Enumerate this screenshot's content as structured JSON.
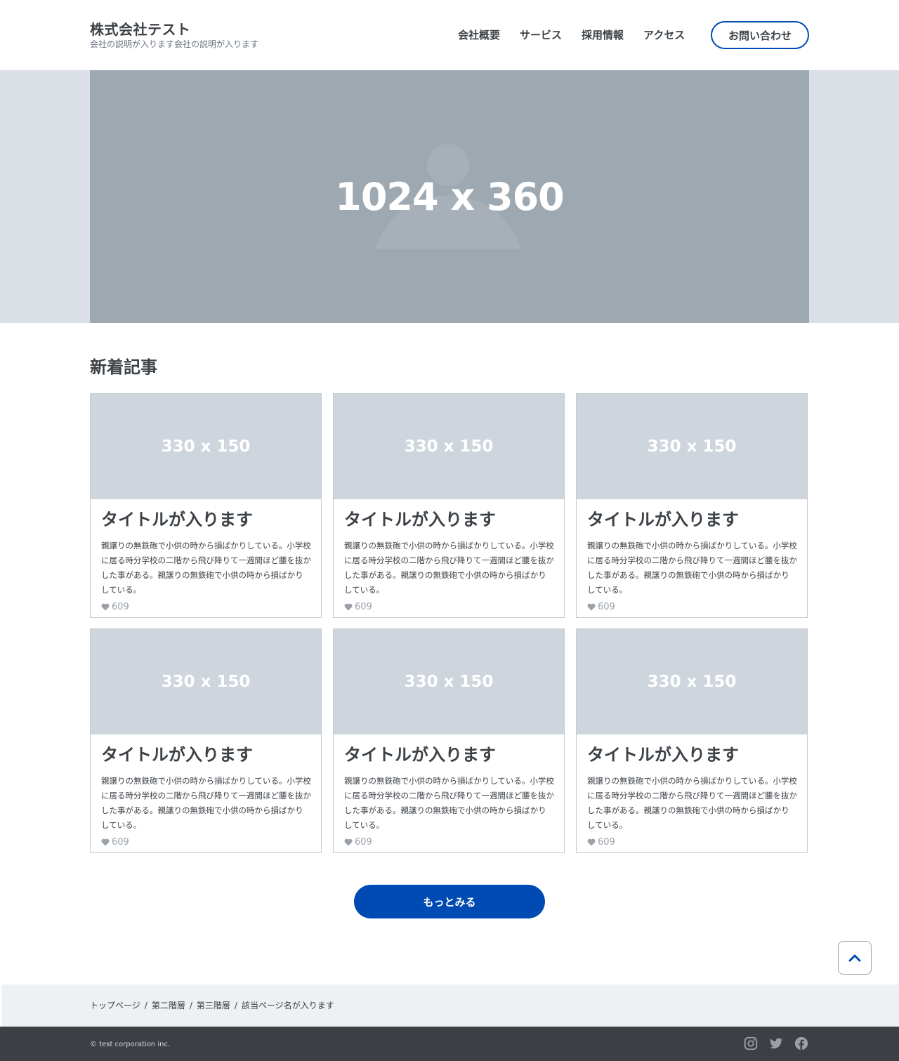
{
  "header": {
    "brand_name": "株式会社テスト",
    "brand_desc": "会社の説明が入ります会社の説明が入ります",
    "nav": [
      {
        "label": "会社概要"
      },
      {
        "label": "サービス"
      },
      {
        "label": "採用情報"
      },
      {
        "label": "アクセス"
      }
    ],
    "contact_label": "お問い合わせ"
  },
  "hero": {
    "label": "1024 x 360"
  },
  "section": {
    "title": "新着記事"
  },
  "cards": [
    {
      "image_label": "330 x 150",
      "title": "タイトルが入ります",
      "text": "親譲りの無鉄砲で小供の時から損ばかりしている。小学校に居る時分学校の二階から飛び降りて一週間ほど腰を抜かした事がある。親譲りの無鉄砲で小供の時から損ばかりしている。",
      "likes": "609"
    },
    {
      "image_label": "330 x 150",
      "title": "タイトルが入ります",
      "text": "親譲りの無鉄砲で小供の時から損ばかりしている。小学校に居る時分学校の二階から飛び降りて一週間ほど腰を抜かした事がある。親譲りの無鉄砲で小供の時から損ばかりしている。",
      "likes": "609"
    },
    {
      "image_label": "330 x 150",
      "title": "タイトルが入ります",
      "text": "親譲りの無鉄砲で小供の時から損ばかりしている。小学校に居る時分学校の二階から飛び降りて一週間ほど腰を抜かした事がある。親譲りの無鉄砲で小供の時から損ばかりしている。",
      "likes": "609"
    },
    {
      "image_label": "330 x 150",
      "title": "タイトルが入ります",
      "text": "親譲りの無鉄砲で小供の時から損ばかりしている。小学校に居る時分学校の二階から飛び降りて一週間ほど腰を抜かした事がある。親譲りの無鉄砲で小供の時から損ばかりしている。",
      "likes": "609"
    },
    {
      "image_label": "330 x 150",
      "title": "タイトルが入ります",
      "text": "親譲りの無鉄砲で小供の時から損ばかりしている。小学校に居る時分学校の二階から飛び降りて一週間ほど腰を抜かした事がある。親譲りの無鉄砲で小供の時から損ばかりしている。",
      "likes": "609"
    },
    {
      "image_label": "330 x 150",
      "title": "タイトルが入ります",
      "text": "親譲りの無鉄砲で小供の時から損ばかりしている。小学校に居る時分学校の二階から飛び降りて一週間ほど腰を抜かした事がある。親譲りの無鉄砲で小供の時から損ばかりしている。",
      "likes": "609"
    }
  ],
  "more_label": "もっとみる",
  "breadcrumb": [
    {
      "label": "トップページ"
    },
    {
      "label": "第二階層"
    },
    {
      "label": "第三階層"
    },
    {
      "label": "該当ページ名が入ります"
    }
  ],
  "breadcrumb_sep": "/",
  "footer": {
    "copyright": "© test corporation inc.",
    "social": [
      {
        "icon": "instagram-icon"
      },
      {
        "icon": "twitter-icon"
      },
      {
        "icon": "facebook-icon"
      }
    ]
  },
  "colors": {
    "accent": "#004ab3",
    "text": "#3c4146",
    "hero_bg": "#9ea8b1",
    "hero_band": "#dbdfe6",
    "card_image": "#ced5dd",
    "footer_bg": "#3c4044",
    "breadcrumb_bg": "#edf1f4"
  }
}
